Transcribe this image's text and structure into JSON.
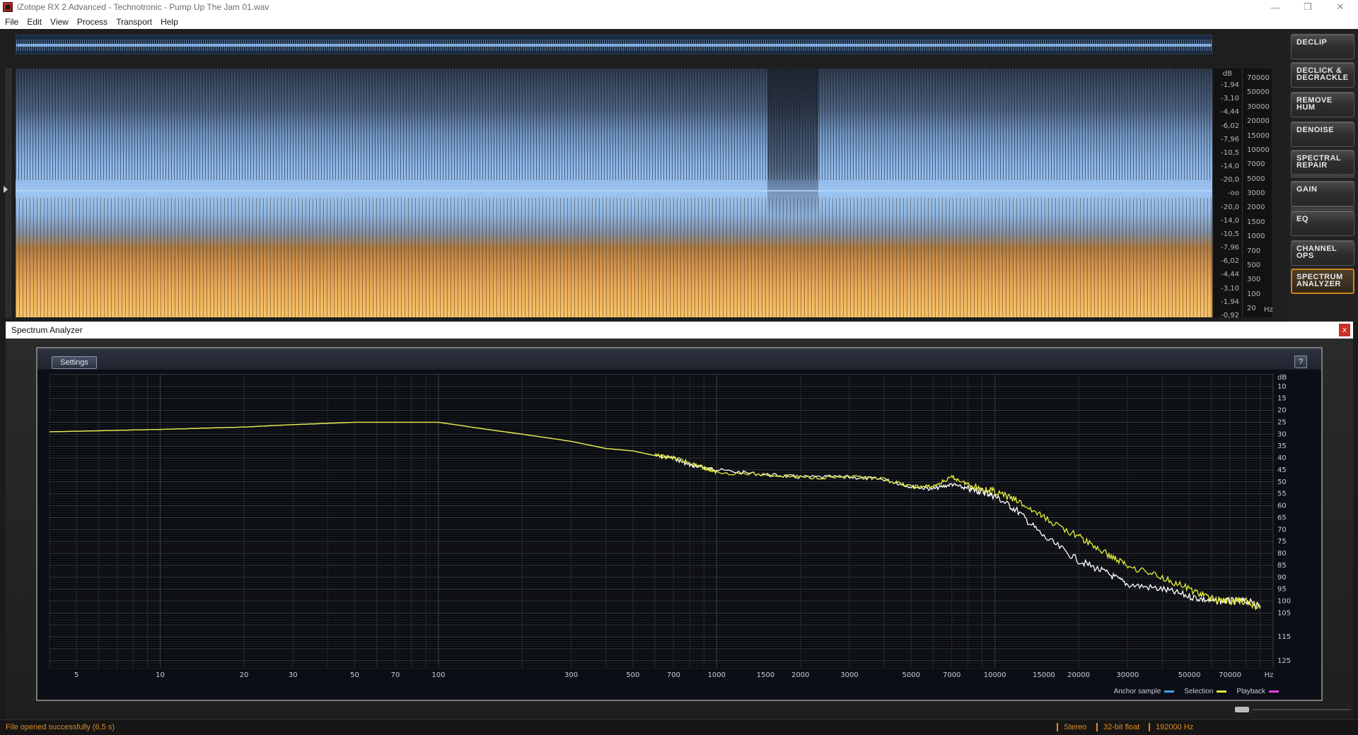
{
  "window": {
    "title": "iZotope RX 2 Advanced - Technotronic - Pump Up The Jam 01.wav",
    "controls": [
      "—",
      "❐",
      "✕"
    ]
  },
  "menu": [
    "File",
    "Edit",
    "View",
    "Process",
    "Transport",
    "Help"
  ],
  "waveform": {
    "db_unit": "dB",
    "db_labels": [
      "-1,94",
      "-3,10",
      "-4,44",
      "-6,02",
      "-7,96",
      "-10,5",
      "-14,0",
      "-20,0",
      "-oo",
      "-20,0",
      "-14,0",
      "-10,5",
      "-7,96",
      "-6,02",
      "-4,44",
      "-3,10",
      "-1,94",
      "-0,92"
    ],
    "hz_labels": [
      "70000",
      "50000",
      "30000",
      "20000",
      "15000",
      "10000",
      "7000",
      "5000",
      "3000",
      "2000",
      "1500",
      "1000",
      "700",
      "500",
      "300",
      "100",
      "20"
    ],
    "hz_unit": "Hz"
  },
  "modules": [
    {
      "label": "DECLIP",
      "active": false
    },
    {
      "label": "DECLICK & DECRACKLE",
      "active": false
    },
    {
      "label": "REMOVE HUM",
      "active": false
    },
    {
      "label": "DENOISE",
      "active": false
    },
    {
      "label": "SPECTRAL REPAIR",
      "active": false
    },
    {
      "label": "GAIN",
      "active": false
    },
    {
      "label": "EQ",
      "active": false
    },
    {
      "label": "CHANNEL OPS",
      "active": false
    },
    {
      "label": "SPECTRUM ANALYZER",
      "active": true
    }
  ],
  "spectrum_window": {
    "title": "Spectrum Analyzer",
    "close": "x",
    "settings_label": "Settings",
    "help_label": "?",
    "legend": [
      {
        "label": "Anchor sample",
        "color": "#3aa6ff"
      },
      {
        "label": "Selection",
        "color": "#e6ee3a"
      },
      {
        "label": "Playback",
        "color": "#e040e0"
      }
    ]
  },
  "chart_data": {
    "type": "line",
    "xscale": "log",
    "x_ticks": [
      "5",
      "10",
      "20",
      "30",
      "50",
      "70",
      "100",
      "300",
      "500",
      "700",
      "1000",
      "1500",
      "2000",
      "3000",
      "5000",
      "7000",
      "10000",
      "15000",
      "20000",
      "30000",
      "50000",
      "70000"
    ],
    "x_unit": "Hz",
    "y_unit": "dB",
    "y_ticks": [
      "10",
      "15",
      "20",
      "25",
      "30",
      "35",
      "40",
      "45",
      "50",
      "55",
      "60",
      "65",
      "70",
      "75",
      "80",
      "85",
      "90",
      "95",
      "100",
      "105",
      "115",
      "125"
    ],
    "ylim": [
      5,
      128
    ],
    "series": [
      {
        "color": "#ffffff",
        "x": [
          4,
          10,
          20,
          30,
          50,
          70,
          100,
          150,
          200,
          300,
          400,
          500,
          600,
          700,
          800,
          900,
          1000,
          1500,
          2000,
          3000,
          4000,
          5000,
          6000,
          7000,
          8000,
          9000,
          10000,
          12000,
          15000,
          20000,
          25000,
          30000,
          40000,
          50000,
          60000,
          70000,
          80000,
          90000
        ],
        "y": [
          29,
          28,
          27,
          26,
          25,
          25,
          25,
          28,
          30,
          33,
          36,
          37,
          39,
          40,
          43,
          44,
          45,
          47,
          48,
          48,
          49,
          52,
          53,
          51,
          53,
          54,
          56,
          62,
          73,
          83,
          88,
          93,
          95,
          98,
          100,
          100,
          100,
          102
        ]
      },
      {
        "color": "#e6ee3a",
        "x": [
          4,
          10,
          20,
          30,
          50,
          70,
          100,
          150,
          200,
          300,
          400,
          500,
          600,
          700,
          800,
          900,
          1000,
          1500,
          2000,
          3000,
          4000,
          5000,
          6000,
          7000,
          8000,
          9000,
          10000,
          12000,
          15000,
          20000,
          25000,
          30000,
          40000,
          50000,
          60000,
          70000,
          80000,
          90000
        ],
        "y": [
          29,
          28,
          27,
          26,
          25,
          25,
          25,
          28,
          30,
          33,
          36,
          37,
          39,
          40,
          42,
          44,
          46,
          47,
          48,
          48,
          49,
          52,
          52,
          48,
          51,
          53,
          54,
          58,
          65,
          73,
          80,
          85,
          90,
          95,
          99,
          100,
          100,
          103
        ]
      }
    ]
  },
  "status": {
    "message": "File opened successfully (6,5 s)",
    "channels": "Stereo",
    "bit_depth": "32-bit float",
    "sample_rate": "192000 Hz"
  }
}
